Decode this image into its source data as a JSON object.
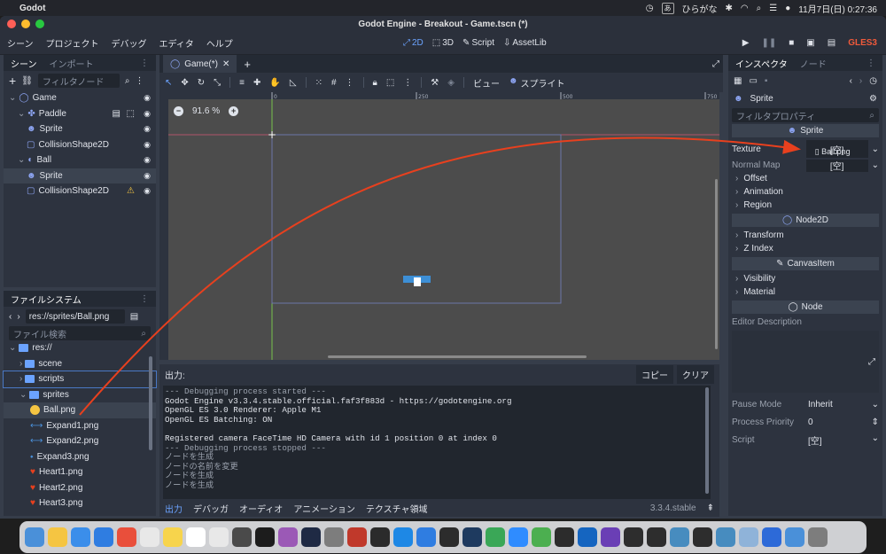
{
  "macos_menubar": {
    "app": "Godot",
    "ime": "ひらがな",
    "datetime": "11月7日(日)  0:27:36"
  },
  "window": {
    "title": "Godot Engine - Breakout - Game.tscn (*)"
  },
  "menubar": {
    "menus": [
      "シーン",
      "プロジェクト",
      "デバッグ",
      "エディタ",
      "ヘルプ"
    ],
    "workspaces": [
      "2D",
      "3D",
      "Script",
      "AssetLib"
    ],
    "active_workspace": "2D",
    "renderer": "GLES3"
  },
  "scene_dock": {
    "tabs": [
      "シーン",
      "インポート"
    ],
    "filter_placeholder": "フィルタノード",
    "tree": [
      {
        "label": "Game",
        "indent": 0,
        "icon": "node2d-icon",
        "color": "#8da5f3"
      },
      {
        "label": "Paddle",
        "indent": 1,
        "icon": "kinematic-icon",
        "color": "#8da5f3"
      },
      {
        "label": "Sprite",
        "indent": 2,
        "icon": "sprite-icon",
        "color": "#8da5f3"
      },
      {
        "label": "CollisionShape2D",
        "indent": 2,
        "icon": "collision-icon",
        "color": "#8da5f3"
      },
      {
        "label": "Ball",
        "indent": 1,
        "icon": "rigidbody-icon",
        "color": "#8da5f3"
      },
      {
        "label": "Sprite",
        "indent": 2,
        "icon": "sprite-icon",
        "color": "#8da5f3",
        "selected": true
      },
      {
        "label": "CollisionShape2D",
        "indent": 2,
        "icon": "collision-icon",
        "color": "#8da5f3",
        "warning": true
      }
    ]
  },
  "filesystem_dock": {
    "tab": "ファイルシステム",
    "path": "res://sprites/Ball.png",
    "search_placeholder": "ファイル検索",
    "items": [
      {
        "label": "res://",
        "indent": 0,
        "type": "folder"
      },
      {
        "label": "scene",
        "indent": 1,
        "type": "folder"
      },
      {
        "label": "scripts",
        "indent": 1,
        "type": "folder"
      },
      {
        "label": "sprites",
        "indent": 1,
        "type": "folder"
      },
      {
        "label": "Ball.png",
        "indent": 2,
        "type": "ball",
        "selected": true
      },
      {
        "label": "Expand1.png",
        "indent": 2,
        "type": "expand"
      },
      {
        "label": "Expand2.png",
        "indent": 2,
        "type": "expand"
      },
      {
        "label": "Expand3.png",
        "indent": 2,
        "type": "expand-small"
      },
      {
        "label": "Heart1.png",
        "indent": 2,
        "type": "heart"
      },
      {
        "label": "Heart2.png",
        "indent": 2,
        "type": "heart"
      },
      {
        "label": "Heart3.png",
        "indent": 2,
        "type": "heart"
      }
    ]
  },
  "editor": {
    "doc_tab": "Game(*)",
    "toolbar_view": "ビュー",
    "toolbar_sprite": "スプライト",
    "zoom": "91.6 %",
    "ruler_marks": [
      "0",
      "250",
      "500",
      "750"
    ]
  },
  "output": {
    "title": "出力:",
    "copy": "コピー",
    "clear": "クリア",
    "log": [
      {
        "text": "--- Debugging process started ---",
        "dim": true
      },
      {
        "text": "Godot Engine v3.3.4.stable.official.faf3f883d - https://godotengine.org",
        "dim": false
      },
      {
        "text": "OpenGL ES 3.0 Renderer: Apple M1",
        "dim": false
      },
      {
        "text": "OpenGL ES Batching: ON",
        "dim": false
      },
      {
        "text": "",
        "dim": false
      },
      {
        "text": "Registered camera FaceTime HD Camera with id 1 position 0 at index 0",
        "dim": false
      },
      {
        "text": "--- Debugging process stopped ---",
        "dim": true
      },
      {
        "text": "ノードを生成",
        "dim": true
      },
      {
        "text": "ノードの名前を変更",
        "dim": true
      },
      {
        "text": "ノードを生成",
        "dim": true
      },
      {
        "text": "ノードを生成",
        "dim": true
      }
    ],
    "bottom_tabs": [
      "出力",
      "デバッガ",
      "オーディオ",
      "アニメーション",
      "テクスチャ領域"
    ],
    "version": "3.3.4.stable"
  },
  "inspector": {
    "tabs": [
      "インスペクタ",
      "ノード"
    ],
    "object": "Sprite",
    "filter_placeholder": "フィルタプロパティ",
    "sprite_section": "Sprite",
    "texture_label": "Texture",
    "texture_value": "[空]",
    "drag_file": "Ball.png",
    "normal_map_label": "Normal Map",
    "normal_map_value": "[空]",
    "groups_sprite": [
      "Offset",
      "Animation",
      "Region"
    ],
    "node2d_section": "Node2D",
    "groups_node2d": [
      "Transform",
      "Z Index"
    ],
    "canvasitem_section": "CanvasItem",
    "groups_canvas": [
      "Visibility",
      "Material"
    ],
    "node_section": "Node",
    "editor_description": "Editor Description",
    "pause_mode_label": "Pause Mode",
    "pause_mode_value": "Inherit",
    "process_priority_label": "Process Priority",
    "process_priority_value": "0",
    "script_label": "Script",
    "script_value": "[空]"
  },
  "dock_colors": [
    "#4a90d9",
    "#f5c542",
    "#3b8eea",
    "#2f7de1",
    "#e94f3b",
    "#e8e8e8",
    "#f7d44c",
    "#ffffff",
    "#e8e8e8",
    "#4a4a4a",
    "#1c1c1c",
    "#9b59b6",
    "#1f2a44",
    "#7d7d7d",
    "#c0392b",
    "#2b2b2b",
    "#1e88e5",
    "#2f7de1",
    "#2c2c2c",
    "#1e3a5f",
    "#3aa757",
    "#2f8cff",
    "#4caf50",
    "#2c2c2c",
    "#1565c0",
    "#6a3fb5",
    "#2d2d2d",
    "#2d2d2d",
    "#478cbf",
    "#2d2d2d",
    "#478cbf",
    "#8fb3d9",
    "#2d6ad8",
    "#4a90d9",
    "#7d7d7d"
  ]
}
